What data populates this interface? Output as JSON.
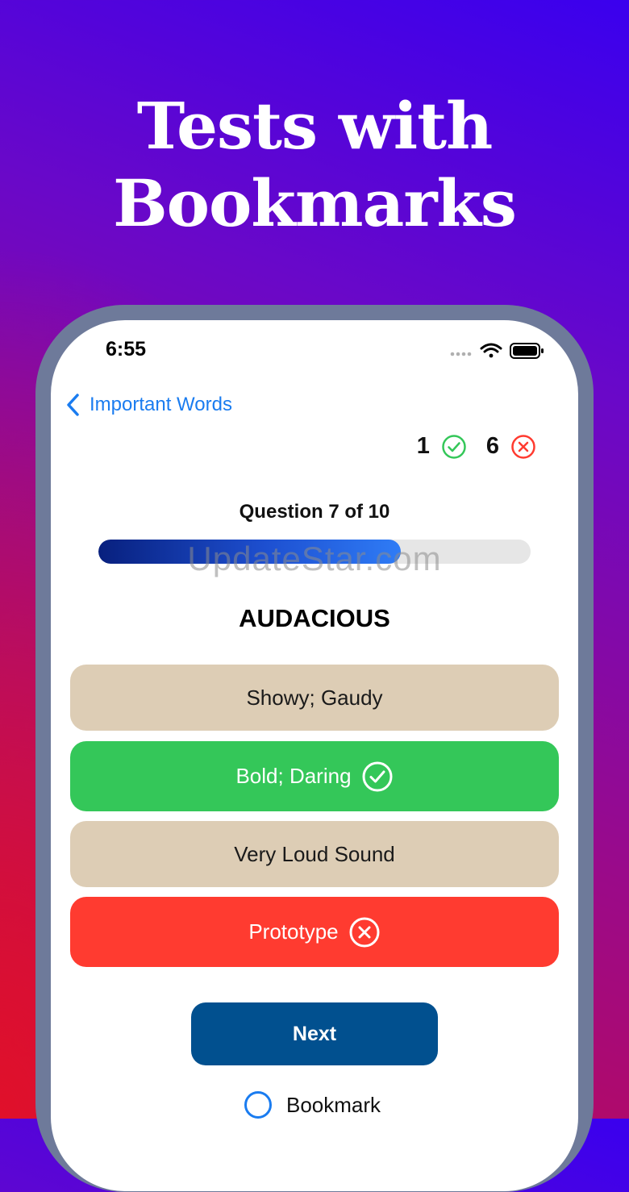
{
  "promo": {
    "headline_line1": "Tests with",
    "headline_line2": "Bookmarks"
  },
  "status_bar": {
    "time": "6:55"
  },
  "nav": {
    "back_label": "Important Words"
  },
  "score": {
    "correct_count": "1",
    "wrong_count": "6"
  },
  "quiz": {
    "question_label": "Question 7 of 10",
    "progress_fraction": 0.7,
    "word": "AUDACIOUS",
    "options": [
      {
        "label": "Showy; Gaudy",
        "state": "neutral"
      },
      {
        "label": "Bold; Daring",
        "state": "correct"
      },
      {
        "label": "Very Loud Sound",
        "state": "neutral"
      },
      {
        "label": "Prototype",
        "state": "wrong"
      }
    ],
    "next_label": "Next",
    "bookmark_label": "Bookmark"
  },
  "watermark": "UpdateStar.com",
  "colors": {
    "accent_blue": "#1a7cf0",
    "correct_green": "#34c759",
    "wrong_red": "#ff3b30",
    "neutral_beige": "#ddcdb5",
    "next_button": "#01508f"
  }
}
